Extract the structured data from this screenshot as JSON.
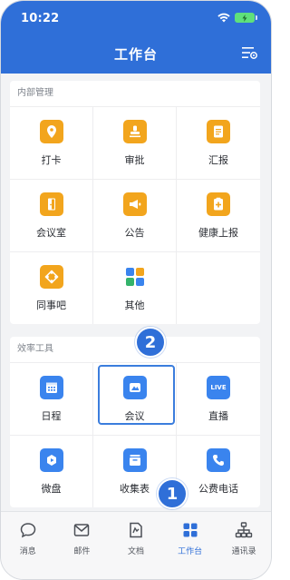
{
  "status_bar": {
    "time": "10:22"
  },
  "header": {
    "title": "工作台",
    "settings_icon": "settings-list-icon"
  },
  "colors": {
    "primary": "#2f6fd8",
    "orange": "#f2a51d",
    "blue": "#3a84ee"
  },
  "internal": {
    "title": "内部管理",
    "items": [
      {
        "label": "打卡",
        "icon": "location-pin-icon"
      },
      {
        "label": "审批",
        "icon": "stamp-icon"
      },
      {
        "label": "汇报",
        "icon": "report-doc-icon"
      },
      {
        "label": "会议室",
        "icon": "door-icon"
      },
      {
        "label": "公告",
        "icon": "megaphone-icon"
      },
      {
        "label": "健康上报",
        "icon": "medical-report-icon"
      },
      {
        "label": "同事吧",
        "icon": "community-icon"
      },
      {
        "label": "其他",
        "icon": "apps-grid-icon"
      }
    ]
  },
  "efficiency": {
    "title": "效率工具",
    "items": [
      {
        "label": "日程",
        "icon": "calendar-icon"
      },
      {
        "label": "会议",
        "icon": "meeting-icon"
      },
      {
        "label": "直播",
        "icon": "live-icon",
        "icon_text": "LIVE"
      },
      {
        "label": "微盘",
        "icon": "cloud-drive-icon"
      },
      {
        "label": "收集表",
        "icon": "collect-form-icon"
      },
      {
        "label": "公费电话",
        "icon": "phone-icon"
      }
    ]
  },
  "annotations": {
    "badge_1": "1",
    "badge_2": "2"
  },
  "tabs": [
    {
      "label": "消息",
      "icon": "chat-bubble-icon"
    },
    {
      "label": "邮件",
      "icon": "mail-icon"
    },
    {
      "label": "文档",
      "icon": "document-icon"
    },
    {
      "label": "工作台",
      "icon": "workbench-grid-icon",
      "active": true
    },
    {
      "label": "通讯录",
      "icon": "org-chart-icon"
    }
  ]
}
